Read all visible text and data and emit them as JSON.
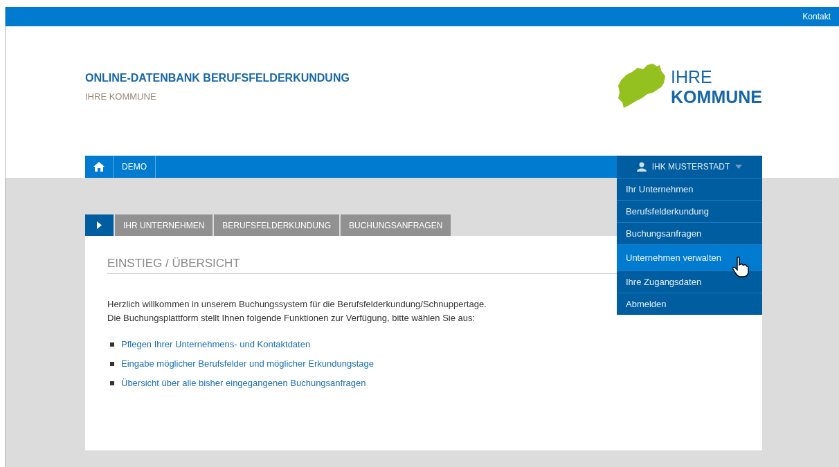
{
  "top_bar": {
    "link": "Kontakt"
  },
  "header": {
    "title": "ONLINE-DATENBANK BERUFSFELDERKUNDUNG",
    "subtitle": "IHRE KOMMUNE",
    "logo_lines": [
      "IHRE",
      "KOMMUNE"
    ]
  },
  "nav": {
    "items": [
      {
        "kind": "home"
      },
      {
        "kind": "text",
        "label": "DEMO"
      }
    ],
    "user_menu": {
      "label": "IHK MUSTERSTADT",
      "expanded": true,
      "items": [
        {
          "label": "Ihr Unternehmen",
          "selected": false
        },
        {
          "label": "Berufsfelderkundung",
          "selected": false
        },
        {
          "label": "Buchungsanfragen",
          "selected": false
        },
        {
          "label": "Unternehmen verwalten",
          "selected": true
        },
        {
          "label": "Ihre Zugangsdaten",
          "selected": false
        },
        {
          "label": "Abmelden",
          "selected": false
        }
      ]
    }
  },
  "tabs": [
    {
      "kind": "arrow",
      "selected": true
    },
    {
      "kind": "text",
      "label": "IHR UNTERNEHMEN",
      "selected": false
    },
    {
      "kind": "text",
      "label": "BERUFSFELDERKUNDUNG",
      "selected": false
    },
    {
      "kind": "text",
      "label": "BUCHUNGSANFRAGEN",
      "selected": false
    }
  ],
  "content": {
    "heading": "EINSTIEG / ÜBERSICHT",
    "intro": [
      "Herzlich willkommen in unserem Buchungssystem für die Berufsfelderkundung/Schnuppertage.",
      "Die Buchungsplattform stellt Ihnen folgende Funktionen zur Verfügung, bitte wählen Sie aus:"
    ],
    "links": [
      "Pflegen Ihrer Unternehmens- und Kontaktdaten",
      "Eingabe möglicher Berufsfelder und möglicher Erkundungstage",
      "Übersicht über alle bisher eingegangenen Buchungsanfragen"
    ]
  }
}
